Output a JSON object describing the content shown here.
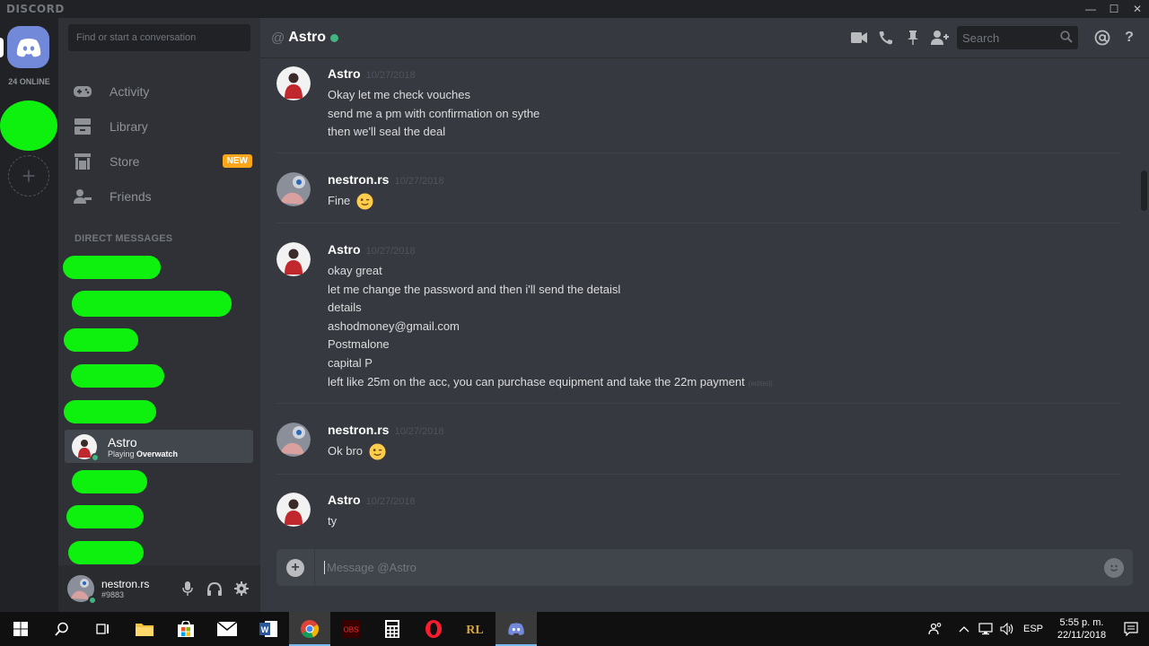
{
  "window": {
    "brand": "DISCORD",
    "minimize": "—",
    "maximize": "☐",
    "close": "✕"
  },
  "guilds": {
    "online_count": "24 ONLINE",
    "add_label": "+"
  },
  "sidebar": {
    "search_placeholder": "Find or start a conversation",
    "nav": [
      {
        "label": "Activity",
        "icon": "controller-icon"
      },
      {
        "label": "Library",
        "icon": "library-icon"
      },
      {
        "label": "Store",
        "icon": "store-icon",
        "badge": "NEW"
      },
      {
        "label": "Friends",
        "icon": "friends-icon"
      }
    ],
    "dm_header": "DIRECT MESSAGES",
    "active_dm": {
      "name": "Astro",
      "status_prefix": "Playing ",
      "status_game": "Overwatch"
    }
  },
  "user": {
    "name": "nestron.rs",
    "tag": "#9883"
  },
  "chat": {
    "at": "@",
    "channel_name": "Astro",
    "search_placeholder": "Search",
    "composer_placeholder": "Message @Astro",
    "messages": [
      {
        "author": "Astro",
        "time": "10/27/2018",
        "lines": [
          "Okay let me check vouches",
          "send me a pm with confirmation on sythe",
          "then we'll seal the deal"
        ]
      },
      {
        "author": "nestron.rs",
        "time": "10/27/2018",
        "lines": [
          "Fine"
        ]
      },
      {
        "author": "Astro",
        "time": "10/27/2018",
        "lines": [
          "okay great",
          "let me change the password and then i'll send the detaisl",
          "details",
          "ashodmoney@gmail.com",
          "Postmalone",
          "capital P",
          "left like 25m on the acc, you can purchase equipment and take the 22m payment"
        ],
        "edited": "(edited)"
      },
      {
        "author": "nestron.rs",
        "time": "10/27/2018",
        "lines": [
          "Ok bro"
        ]
      },
      {
        "author": "Astro",
        "time": "10/27/2018",
        "lines": [
          "ty"
        ]
      }
    ]
  },
  "taskbar": {
    "lang": "ESP",
    "time": "5:55 p. m.",
    "date": "22/11/2018"
  },
  "colors": {
    "accent": "#7289da",
    "online": "#43b581",
    "badge": "#faa61a",
    "redaction": "#0ef10e"
  }
}
